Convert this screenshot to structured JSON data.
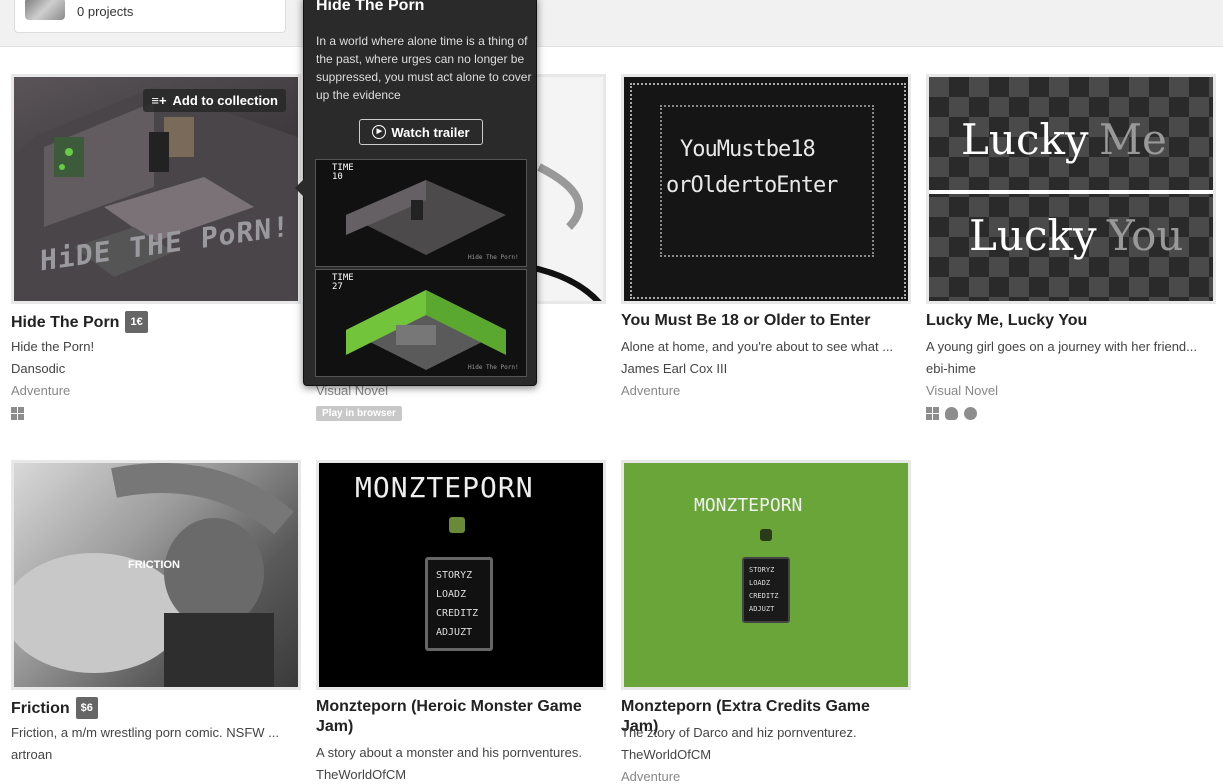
{
  "profile": {
    "projects": "0 projects"
  },
  "popup": {
    "title": "Hide The Porn",
    "description": "In a world where alone time is a thing of the past, where urges can no longer be suppressed, you must act alone to cover up the evidence",
    "trailer_label": "Watch trailer",
    "shot1_time": "TIME\n10",
    "shot2_time": "TIME\n27",
    "shot_caption": "Hide The Porn!"
  },
  "games": [
    {
      "title": "Hide The Porn",
      "price": "1€",
      "description": "Hide the Porn!",
      "author": "Dansodic",
      "genre": "Adventure",
      "platforms": [
        "windows-icon"
      ],
      "collect_label": "Add to collection",
      "art_text": "HiDE THE PoRN!"
    },
    {
      "title": "",
      "description": "…rytelling, ...",
      "genre": "Visual Novel",
      "badge": "Play in browser"
    },
    {
      "title": "You Must Be 18 or Older to Enter",
      "description": "Alone at home, and you're about to see what ...",
      "author": "James Earl Cox III",
      "genre": "Adventure",
      "art_line1": "YouMustbe18",
      "art_line2": "orOldertoEnter"
    },
    {
      "title": "Lucky Me, Lucky You",
      "description": "A young girl goes on a journey with her friend...",
      "author": "ebi-hime",
      "genre": "Visual Novel",
      "platforms": [
        "windows-icon",
        "linux-icon",
        "apple-icon"
      ],
      "art_top_a": "Lucky",
      "art_top_b": "Me",
      "art_bot_a": "Lucky",
      "art_bot_b": "You"
    },
    {
      "title": "Friction",
      "price": "$6",
      "description": "Friction, a m/m wrestling porn comic. NSFW ...",
      "author": "artroan",
      "art_text": "FRICTION"
    },
    {
      "title": "Monzteporn (Heroic Monster Game Jam)",
      "description": "A story about a monster and his pornventures.",
      "author": "TheWorldOfCM",
      "art_title": "MONZTEPORN",
      "menu": [
        "STORYZ",
        "LOADZ",
        "CREDITZ",
        "ADJUZT"
      ]
    },
    {
      "title": "Monzteporn (Extra Credits Game Jam)",
      "description": "The ztory of Darco and hiz pornventurez.",
      "author": "TheWorldOfCM",
      "genre": "Adventure",
      "art_title": "MONZTEPORN",
      "menu": [
        "STORYZ",
        "LOADZ",
        "CREDITZ",
        "ADJUZT"
      ]
    }
  ]
}
